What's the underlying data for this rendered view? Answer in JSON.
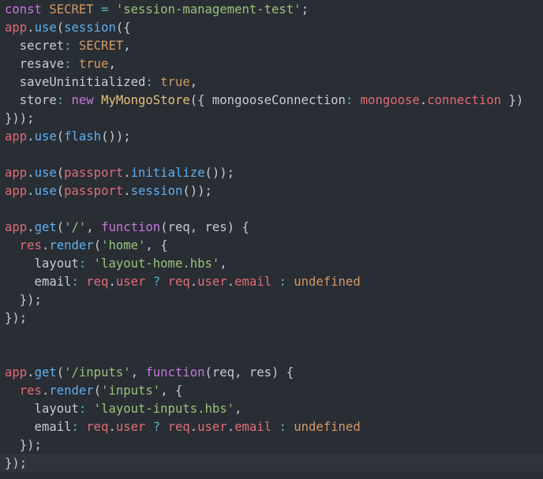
{
  "editor": {
    "language": "javascript",
    "colors": {
      "background": "#292d34",
      "current_line": "#2f333b",
      "default": "#c6cbd3",
      "keyword": "#c678dd",
      "variable": "#e06c75",
      "function": "#61afef",
      "string": "#98c379",
      "constant": "#d19a66",
      "class": "#e5c07b",
      "operator": "#56b6c2"
    },
    "lines": [
      [
        {
          "t": "keyword",
          "v": "const "
        },
        {
          "t": "constant",
          "v": "SECRET"
        },
        {
          "t": "default",
          "v": " "
        },
        {
          "t": "operator",
          "v": "="
        },
        {
          "t": "default",
          "v": " "
        },
        {
          "t": "string",
          "v": "'session-management-test'"
        },
        {
          "t": "default",
          "v": ";"
        }
      ],
      [
        {
          "t": "variable",
          "v": "app"
        },
        {
          "t": "default",
          "v": "."
        },
        {
          "t": "function",
          "v": "use"
        },
        {
          "t": "default",
          "v": "("
        },
        {
          "t": "function",
          "v": "session"
        },
        {
          "t": "default",
          "v": "({"
        }
      ],
      [
        {
          "t": "default",
          "v": "  secret"
        },
        {
          "t": "operator",
          "v": ":"
        },
        {
          "t": "default",
          "v": " "
        },
        {
          "t": "constant",
          "v": "SECRET"
        },
        {
          "t": "default",
          "v": ","
        }
      ],
      [
        {
          "t": "default",
          "v": "  resave"
        },
        {
          "t": "operator",
          "v": ":"
        },
        {
          "t": "default",
          "v": " "
        },
        {
          "t": "constant",
          "v": "true"
        },
        {
          "t": "default",
          "v": ","
        }
      ],
      [
        {
          "t": "default",
          "v": "  saveUninitialized"
        },
        {
          "t": "operator",
          "v": ":"
        },
        {
          "t": "default",
          "v": " "
        },
        {
          "t": "constant",
          "v": "true"
        },
        {
          "t": "default",
          "v": ","
        }
      ],
      [
        {
          "t": "default",
          "v": "  store"
        },
        {
          "t": "operator",
          "v": ":"
        },
        {
          "t": "default",
          "v": " "
        },
        {
          "t": "keyword",
          "v": "new"
        },
        {
          "t": "default",
          "v": " "
        },
        {
          "t": "class",
          "v": "MyMongoStore"
        },
        {
          "t": "default",
          "v": "({ mongooseConnection"
        },
        {
          "t": "operator",
          "v": ":"
        },
        {
          "t": "default",
          "v": " "
        },
        {
          "t": "variable",
          "v": "mongoose"
        },
        {
          "t": "default",
          "v": "."
        },
        {
          "t": "variable",
          "v": "connection"
        },
        {
          "t": "default",
          "v": " })"
        }
      ],
      [
        {
          "t": "default",
          "v": "}));"
        }
      ],
      [
        {
          "t": "variable",
          "v": "app"
        },
        {
          "t": "default",
          "v": "."
        },
        {
          "t": "function",
          "v": "use"
        },
        {
          "t": "default",
          "v": "("
        },
        {
          "t": "function",
          "v": "flash"
        },
        {
          "t": "default",
          "v": "());"
        }
      ],
      [],
      [
        {
          "t": "variable",
          "v": "app"
        },
        {
          "t": "default",
          "v": "."
        },
        {
          "t": "function",
          "v": "use"
        },
        {
          "t": "default",
          "v": "("
        },
        {
          "t": "variable",
          "v": "passport"
        },
        {
          "t": "default",
          "v": "."
        },
        {
          "t": "function",
          "v": "initialize"
        },
        {
          "t": "default",
          "v": "());"
        }
      ],
      [
        {
          "t": "variable",
          "v": "app"
        },
        {
          "t": "default",
          "v": "."
        },
        {
          "t": "function",
          "v": "use"
        },
        {
          "t": "default",
          "v": "("
        },
        {
          "t": "variable",
          "v": "passport"
        },
        {
          "t": "default",
          "v": "."
        },
        {
          "t": "function",
          "v": "session"
        },
        {
          "t": "default",
          "v": "());"
        }
      ],
      [],
      [
        {
          "t": "variable",
          "v": "app"
        },
        {
          "t": "default",
          "v": "."
        },
        {
          "t": "function",
          "v": "get"
        },
        {
          "t": "default",
          "v": "("
        },
        {
          "t": "string",
          "v": "'/'"
        },
        {
          "t": "default",
          "v": ", "
        },
        {
          "t": "keyword",
          "v": "function"
        },
        {
          "t": "default",
          "v": "(req, res) {"
        }
      ],
      [
        {
          "t": "default",
          "v": "  "
        },
        {
          "t": "variable",
          "v": "res"
        },
        {
          "t": "default",
          "v": "."
        },
        {
          "t": "function",
          "v": "render"
        },
        {
          "t": "default",
          "v": "("
        },
        {
          "t": "string",
          "v": "'home'"
        },
        {
          "t": "default",
          "v": ", {"
        }
      ],
      [
        {
          "t": "default",
          "v": "    layout"
        },
        {
          "t": "operator",
          "v": ":"
        },
        {
          "t": "default",
          "v": " "
        },
        {
          "t": "string",
          "v": "'layout-home.hbs'"
        },
        {
          "t": "default",
          "v": ","
        }
      ],
      [
        {
          "t": "default",
          "v": "    email"
        },
        {
          "t": "operator",
          "v": ":"
        },
        {
          "t": "default",
          "v": " "
        },
        {
          "t": "variable",
          "v": "req"
        },
        {
          "t": "default",
          "v": "."
        },
        {
          "t": "variable",
          "v": "user"
        },
        {
          "t": "default",
          "v": " "
        },
        {
          "t": "operator",
          "v": "?"
        },
        {
          "t": "default",
          "v": " "
        },
        {
          "t": "variable",
          "v": "req"
        },
        {
          "t": "default",
          "v": "."
        },
        {
          "t": "variable",
          "v": "user"
        },
        {
          "t": "default",
          "v": "."
        },
        {
          "t": "variable",
          "v": "email"
        },
        {
          "t": "default",
          "v": " "
        },
        {
          "t": "operator",
          "v": ":"
        },
        {
          "t": "default",
          "v": " "
        },
        {
          "t": "constant",
          "v": "undefined"
        }
      ],
      [
        {
          "t": "default",
          "v": "  });"
        }
      ],
      [
        {
          "t": "default",
          "v": "});"
        }
      ],
      [],
      [],
      [
        {
          "t": "variable",
          "v": "app"
        },
        {
          "t": "default",
          "v": "."
        },
        {
          "t": "function",
          "v": "get"
        },
        {
          "t": "default",
          "v": "("
        },
        {
          "t": "string",
          "v": "'/inputs'"
        },
        {
          "t": "default",
          "v": ", "
        },
        {
          "t": "keyword",
          "v": "function"
        },
        {
          "t": "default",
          "v": "(req, res) {"
        }
      ],
      [
        {
          "t": "default",
          "v": "  "
        },
        {
          "t": "variable",
          "v": "res"
        },
        {
          "t": "default",
          "v": "."
        },
        {
          "t": "function",
          "v": "render"
        },
        {
          "t": "default",
          "v": "("
        },
        {
          "t": "string",
          "v": "'inputs'"
        },
        {
          "t": "default",
          "v": ", {"
        }
      ],
      [
        {
          "t": "default",
          "v": "    layout"
        },
        {
          "t": "operator",
          "v": ":"
        },
        {
          "t": "default",
          "v": " "
        },
        {
          "t": "string",
          "v": "'layout-inputs.hbs'"
        },
        {
          "t": "default",
          "v": ","
        }
      ],
      [
        {
          "t": "default",
          "v": "    email"
        },
        {
          "t": "operator",
          "v": ":"
        },
        {
          "t": "default",
          "v": " "
        },
        {
          "t": "variable",
          "v": "req"
        },
        {
          "t": "default",
          "v": "."
        },
        {
          "t": "variable",
          "v": "user"
        },
        {
          "t": "default",
          "v": " "
        },
        {
          "t": "operator",
          "v": "?"
        },
        {
          "t": "default",
          "v": " "
        },
        {
          "t": "variable",
          "v": "req"
        },
        {
          "t": "default",
          "v": "."
        },
        {
          "t": "variable",
          "v": "user"
        },
        {
          "t": "default",
          "v": "."
        },
        {
          "t": "variable",
          "v": "email"
        },
        {
          "t": "default",
          "v": " "
        },
        {
          "t": "operator",
          "v": ":"
        },
        {
          "t": "default",
          "v": " "
        },
        {
          "t": "constant",
          "v": "undefined"
        }
      ],
      [
        {
          "t": "default",
          "v": "  });"
        }
      ],
      [
        {
          "t": "default",
          "v": "});"
        }
      ]
    ]
  }
}
